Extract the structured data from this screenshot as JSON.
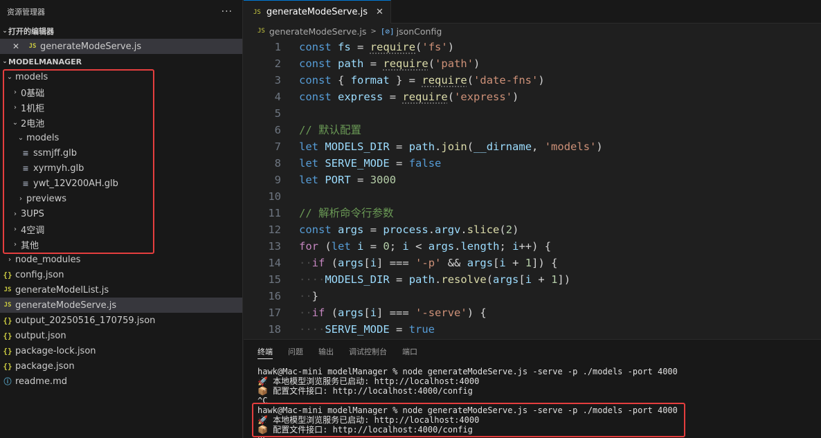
{
  "sidebar": {
    "title": "资源管理器",
    "more": "···",
    "open_editors": {
      "title": "打开的编辑器",
      "items": [
        {
          "icon": "JS",
          "label": "generateModeServe.js",
          "close": "✕"
        }
      ]
    },
    "workspace": {
      "title": "MODELMANAGER",
      "tree": [
        {
          "chev": "v",
          "icon": "",
          "label": "models"
        },
        {
          "chev": ">",
          "icon": "",
          "label": "0基础"
        },
        {
          "chev": ">",
          "icon": "",
          "label": "1机柜"
        },
        {
          "chev": "v",
          "icon": "",
          "label": "2电池"
        },
        {
          "chev": "v",
          "icon": "",
          "label": "models"
        },
        {
          "chev": "",
          "icon": "≡",
          "label": "ssmjff.glb"
        },
        {
          "chev": "",
          "icon": "≡",
          "label": "xyrmyh.glb"
        },
        {
          "chev": "",
          "icon": "≡",
          "label": "ywt_12V200AH.glb"
        },
        {
          "chev": ">",
          "icon": "",
          "label": "previews"
        },
        {
          "chev": ">",
          "icon": "",
          "label": "3UPS"
        },
        {
          "chev": ">",
          "icon": "",
          "label": "4空调"
        },
        {
          "chev": ">",
          "icon": "",
          "label": "其他"
        },
        {
          "chev": ">",
          "icon": "",
          "label": "node_modules"
        },
        {
          "chev": "",
          "icon": "{}",
          "label": "config.json"
        },
        {
          "chev": "",
          "icon": "JS",
          "label": "generateModelList.js"
        },
        {
          "chev": "",
          "icon": "JS",
          "label": "generateModeServe.js"
        },
        {
          "chev": "",
          "icon": "{}",
          "label": "output_20250516_170759.json"
        },
        {
          "chev": "",
          "icon": "{}",
          "label": "output.json"
        },
        {
          "chev": "",
          "icon": "{}",
          "label": "package-lock.json"
        },
        {
          "chev": "",
          "icon": "{}",
          "label": "package.json"
        },
        {
          "chev": "",
          "icon": "ⓘ",
          "label": "readme.md"
        }
      ]
    }
  },
  "editor": {
    "tab": {
      "icon": "JS",
      "label": "generateModeServe.js",
      "close": "✕"
    },
    "breadcrumb": {
      "icon": "JS",
      "file": "generateModeServe.js",
      "sep": ">",
      "symbol_icon": "[⊘]",
      "symbol": "jsonConfig"
    },
    "lines": [
      "1",
      "2",
      "3",
      "4",
      "5",
      "6",
      "7",
      "8",
      "9",
      "10",
      "11",
      "12",
      "13",
      "14",
      "15",
      "16",
      "17",
      "18"
    ]
  },
  "panel": {
    "tabs": [
      "终端",
      "问题",
      "输出",
      "调试控制台",
      "端口"
    ],
    "terminal": [
      "hawk@Mac-mini modelManager % node generateModeServe.js -serve -p ./models -port 4000",
      "🚀 本地模型浏览服务已启动: http://localhost:4000",
      "📦 配置文件接口: http://localhost:4000/config",
      "^C",
      "hawk@Mac-mini modelManager % node generateModeServe.js -serve -p ./models -port 4000",
      "🚀 本地模型浏览服务已启动: http://localhost:4000",
      "📦 配置文件接口: http://localhost:4000/config",
      "^C"
    ]
  },
  "colors": {
    "accent": "#0078d4",
    "highlight": "#e53e3e",
    "js_icon": "#cbcb41"
  }
}
